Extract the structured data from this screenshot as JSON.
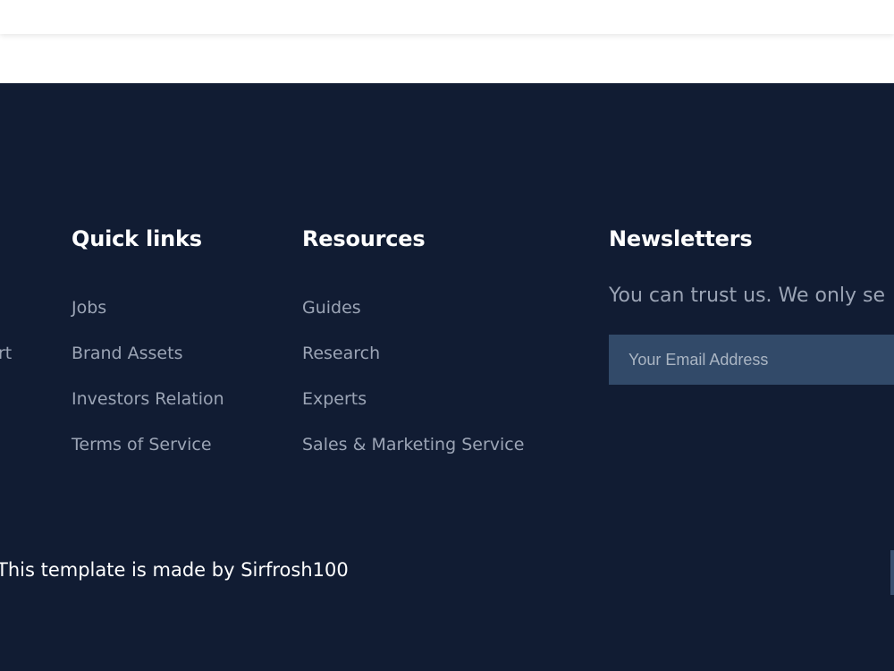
{
  "footer": {
    "partial_link": "rt",
    "quick_links": {
      "heading": "Quick links",
      "items": [
        "Jobs",
        "Brand Assets",
        "Investors Relation",
        "Terms of Service"
      ]
    },
    "resources": {
      "heading": "Resources",
      "items": [
        "Guides",
        "Research",
        "Experts",
        "Sales & Marketing Service"
      ]
    },
    "newsletters": {
      "heading": "Newsletters",
      "description": "You can trust us. We only se",
      "email_placeholder": "Your Email Address",
      "email_value": ""
    },
    "credit": "This template is made by Sirfrosh100"
  },
  "colors": {
    "footer_bg": "#111c33",
    "heading": "#ffffff",
    "link": "#9ba4b5",
    "input_bg": "#324a69"
  }
}
